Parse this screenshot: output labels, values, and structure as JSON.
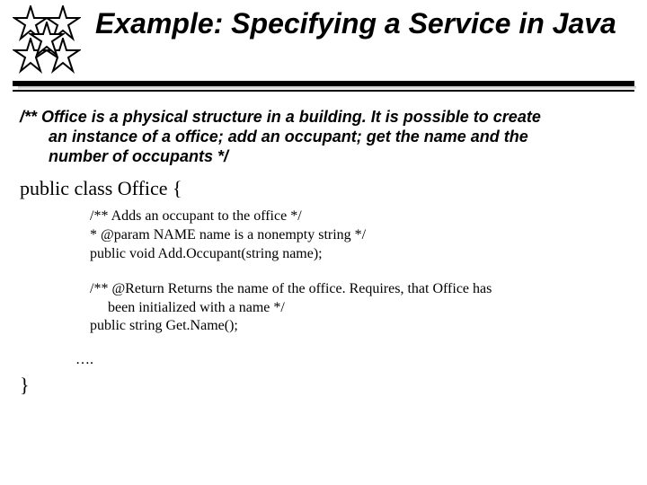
{
  "title": "Example: Specifying a Service in Java",
  "doc": {
    "lead": "/** Office is a physical structure in a building. It is possible to create",
    "cont1": "an instance of a office; add an occupant; get the name and the",
    "cont2": "number of occupants */"
  },
  "classDecl": "public class Office {",
  "method1": {
    "l1": "/** Adds an occupant to the office */",
    "l2": "* @param  NAME  name is a nonempty string */",
    "l3": "public void Add.Occupant(string name);"
  },
  "method2": {
    "l1": "/** @Return Returns the name of the office. Requires, that Office has",
    "l1b": "been initialized with a name */",
    "l2": "public string Get.Name();"
  },
  "ellipsis": "….",
  "closeBrace": "}"
}
